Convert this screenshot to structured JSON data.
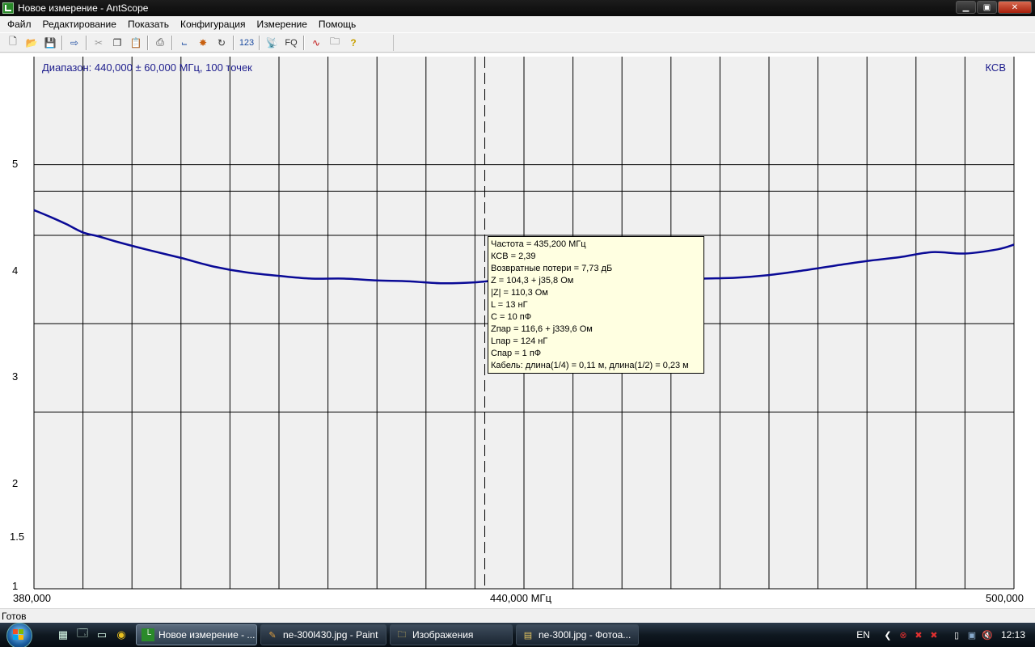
{
  "window": {
    "title": "Новое измерение - AntScope"
  },
  "menu": [
    "Файл",
    "Редактирование",
    "Показать",
    "Конфигурация",
    "Измерение",
    "Помощь"
  ],
  "toolbar": {
    "btn_123": "123",
    "btn_fq": "FQ"
  },
  "chart": {
    "header_left": "Диапазон: 440,000 ± 60,000 МГц, 100 точек",
    "header_right": "КСВ",
    "x_tick_left": "380,000",
    "x_tick_center": "440,000 МГц",
    "x_tick_right": "500,000",
    "y_ticks": [
      "5",
      "4",
      "3",
      "2",
      "1.5",
      "1"
    ]
  },
  "chart_data": {
    "type": "line",
    "title": "Диапазон: 440,000 ± 60,000 МГц, 100 точек",
    "xlabel": "МГц",
    "ylabel": "КСВ",
    "xlim": [
      380,
      500
    ],
    "ylim": [
      1,
      6.5
    ],
    "y_scale": "reciprocal (tick values 1, 1.5, 2, 3, 4, 5)",
    "grid": true,
    "line_color": "#0a0a96",
    "cursor_x": 435.2,
    "series": [
      {
        "x": [
          380,
          382,
          384,
          386,
          388,
          390,
          394,
          398,
          402,
          406,
          410,
          414,
          418,
          422,
          426,
          430,
          434,
          438,
          442,
          446,
          450,
          454,
          458,
          462,
          466,
          470,
          474,
          478,
          482,
          486,
          490,
          494,
          498,
          500
        ],
        "values": [
          3.5,
          3.35,
          3.2,
          3.05,
          2.98,
          2.9,
          2.77,
          2.66,
          2.55,
          2.48,
          2.44,
          2.41,
          2.41,
          2.39,
          2.38,
          2.36,
          2.37,
          2.4,
          2.38,
          2.36,
          2.35,
          2.37,
          2.4,
          2.41,
          2.42,
          2.45,
          2.5,
          2.56,
          2.62,
          2.67,
          2.74,
          2.72,
          2.78,
          2.85
        ]
      }
    ]
  },
  "tooltip": {
    "lines": [
      "Частота = 435,200 МГц",
      "КСВ = 2,39",
      "Возвратные потери = 7,73 дБ",
      "Z = 104,3 + j35,8 Ом",
      "|Z| = 110,3 Ом",
      "L = 13 нГ",
      "C = 10 пФ",
      "Zпар = 116,6 + j339,6 Ом",
      "Lпар = 124 нГ",
      "Cпар = 1 пФ",
      "Кабель: длина(1/4) = 0,11 м, длина(1/2) = 0,23 м"
    ]
  },
  "status": {
    "text": "Готов"
  },
  "taskbar": {
    "tasks": [
      {
        "label": "Новое измерение - ...",
        "active": true
      },
      {
        "label": "ne-300l430.jpg - Paint",
        "active": false
      },
      {
        "label": "Изображения",
        "active": false
      },
      {
        "label": "ne-300l.jpg - Фотоа...",
        "active": false
      }
    ],
    "lang": "EN",
    "clock": "12:13"
  }
}
